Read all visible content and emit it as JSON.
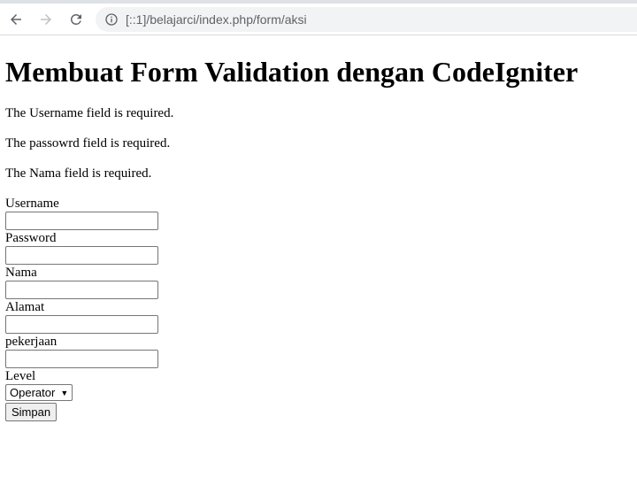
{
  "browser": {
    "url": "[::1]/belajarci/index.php/form/aksi"
  },
  "page": {
    "title": "Membuat Form Validation dengan CodeIgniter",
    "errors": [
      "The Username field is required.",
      "The passowrd field is required.",
      "The Nama field is required."
    ],
    "fields": [
      {
        "label": "Username",
        "value": ""
      },
      {
        "label": "Password",
        "value": ""
      },
      {
        "label": "Nama",
        "value": ""
      },
      {
        "label": "Alamat",
        "value": ""
      },
      {
        "label": "pekerjaan",
        "value": ""
      }
    ],
    "level": {
      "label": "Level",
      "selected": "Operator"
    },
    "submit_label": "Simpan"
  },
  "icons": {
    "back": "back-arrow-icon",
    "forward": "forward-arrow-icon",
    "reload": "reload-icon",
    "info": "info-icon",
    "dropdown": "chevron-down-icon"
  }
}
